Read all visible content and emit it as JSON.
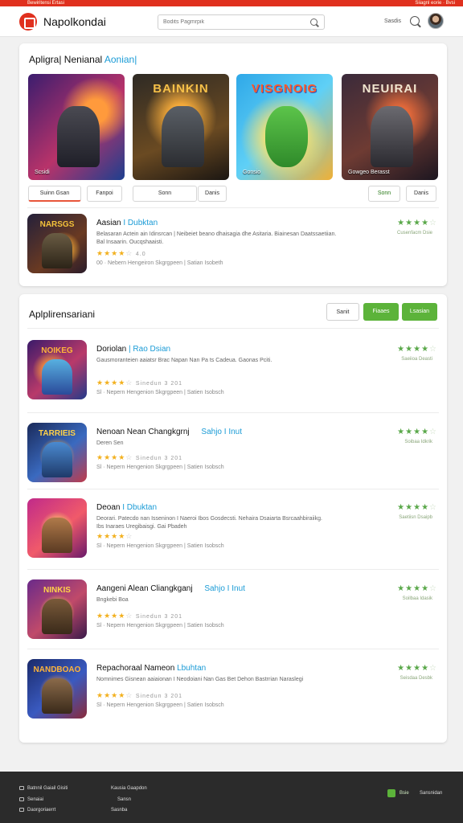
{
  "topstrip": {
    "left": "Bewiritensi Ertasi",
    "right": "Siiagnl eorie · Bvsi"
  },
  "header": {
    "brand": "Napolkondai",
    "search_placeholder": "Bodits Pagmrpik",
    "link": "Sasdis"
  },
  "featured": {
    "title_prefix": "Apligra| Nenianal",
    "title_accent": "Aonian|",
    "tiles": [
      {
        "title": "",
        "caption": "Scsidi"
      },
      {
        "title": "BAINKIN",
        "caption": ""
      },
      {
        "title": "VISGNOIG",
        "caption": "Gonsio"
      },
      {
        "title": "NEUIRAI",
        "caption": "Gowgeo Berasst"
      }
    ],
    "chips": [
      "Suinn Gsan",
      "Fanpoi",
      "Sonn",
      "Danis",
      "Sonn",
      "Danis"
    ],
    "highlight": {
      "icon_title": "NARSGS",
      "name_prefix": "Aasian",
      "name_accent": "I Dubktan",
      "desc": "Belasaran Actein ain Idinsrcan | Neibeiet beano dhaisagia dhe Asitaria. Biainesan Daatssaetiian. Bal Insaarin. Oucqshaaisti.",
      "rating_num": "4.0",
      "meta": "00 · Nebern Hengeiron Skgrgpeen | Satian Isobeth",
      "right_label": "Cusenfacm Dsie"
    }
  },
  "apps_section": {
    "title": "Aplplirensariani",
    "buttons": {
      "outline": "Sanit",
      "green1": "Fiaaes",
      "green2": "Lsasian"
    },
    "apps": [
      {
        "icon_title": "NOIKEG",
        "name_prefix": "Doriolan",
        "name_accent": "| Rao Dsian",
        "desc": "Gausmoranteien aaiatsr Brac Napan Nan Pa ts Cadeua. Gaonas Pciti.",
        "rating_num": "Sinedun 3 201",
        "meta": "Sl · Nepern Hengenion Skgrgpeen | Satien Isobsch",
        "right_label": "Saeiioa Deasti"
      },
      {
        "icon_title": "TARRIEIS",
        "name_prefix": "Nenoan Nean Changkgrnj",
        "name_accent": "Sahjo I Inut",
        "desc": "Deren Sen",
        "rating_num": "Sinedun 3 201",
        "meta": "Sl · Nepern Hengenion Skgrgpeen | Satien Isobsch",
        "right_label": "Soibaa Idkrik"
      },
      {
        "icon_title": "",
        "name_prefix": "Deoan",
        "name_accent": "I Dbuktan",
        "desc": "Deorari. Patecdo nan Isseninon I Naeroi Ibos Gosdecsti. Nehaira Dsaiarta Bsrcaahbiraiikg. Ibs Inaraes Uregibaisgi. Gai Pbadeh",
        "rating_num": "",
        "meta": "Sl · Nepern Hengenion Skgrgpeen | Satien Isobsch",
        "right_label": "Saetiisn Dsaipb"
      },
      {
        "icon_title": "NINKIS",
        "name_prefix": "Aangeni Alean Cliangkganj",
        "name_accent": "Sahjo I Inut",
        "desc": "Bngkebi Boa",
        "rating_num": "Sinedun 3 201",
        "meta": "Sl · Nepern Hengenion Skgrgpeen | Satien Isobsch",
        "right_label": "Soilbaa Idasik"
      },
      {
        "icon_title": "NANDBOAO",
        "name_prefix": "Repachoraal Nameon",
        "name_accent": "Lbuhtan",
        "desc": "Nomnimes Gisnean aaiaionan I Neodoiani Nan Gas Bet Dehon Bastrrian Naraslegi",
        "rating_num": "Sinedun 3 201",
        "meta": "Sl · Nepern Hengenion Skgrgpeen | Satien Isobsch",
        "right_label": "Seisdaa Desbk"
      }
    ]
  },
  "footer": {
    "left": [
      "Batnnil Gaiail Gisiti",
      "Senaiai",
      "Daorgoriaerrt"
    ],
    "mid": [
      "Kausia Gaapdon",
      "Sansn",
      "Sasnba"
    ],
    "badge": "Bsie",
    "badge_text": "Sansnidan"
  },
  "colors": {
    "accent_red": "#e0301e",
    "accent_blue": "#1a9bd6",
    "accent_green": "#5cb33a"
  }
}
